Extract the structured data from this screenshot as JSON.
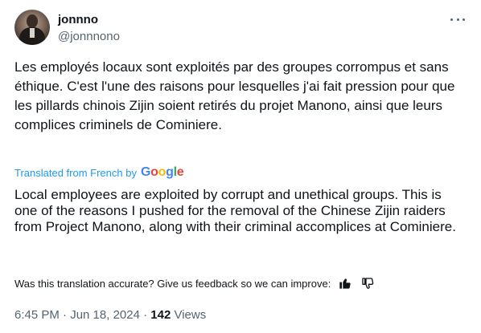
{
  "author": {
    "name": "jonnno",
    "handle": "@jonnnono"
  },
  "tweet": {
    "original_text": "Les employés locaux sont exploités par des groupes corrompus et sans éthique. C'est l'une des raisons pour lesquelles j'ai fait pression pour que les pillards chinois Zijin soient retirés du projet Manono, ainsi que leurs complices criminels de Cominiere.",
    "translated_label": "Translated from French by",
    "translator_logo": "Google",
    "translated_text": "Local employees are exploited by corrupt and unethical groups. This is one of the reasons I pushed for the removal of the Chinese Zijin raiders from Project Manono, along with their criminal accomplices at Cominiere.",
    "feedback_prompt": "Was this translation accurate? Give us feedback so we can improve:",
    "timestamp": "6:45 PM · Jun 18, 2024",
    "separator": " · ",
    "views_count": "142",
    "views_label": "Views"
  },
  "icons": {
    "more": "more-horizontal-icon",
    "thumbs_up": "thumbs-up-icon",
    "thumbs_down": "thumbs-down-icon"
  },
  "colors": {
    "link_blue": "#1d9bf0",
    "secondary_text": "#536471",
    "primary_text": "#0f1419"
  }
}
